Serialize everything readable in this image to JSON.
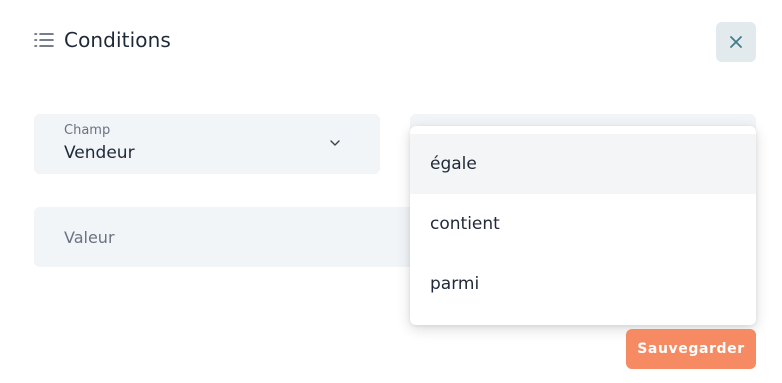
{
  "header": {
    "title": "Conditions",
    "icon": "list-icon"
  },
  "close_button": {
    "icon": "close-icon",
    "color": "#437a8c"
  },
  "field_select": {
    "label": "Champ",
    "value": "Vendeur",
    "icon": "chevron-down-icon"
  },
  "operator_select": {
    "options": [
      "égale",
      "contient",
      "parmi"
    ],
    "highlighted_index": 0
  },
  "value_input": {
    "placeholder": "Valeur",
    "value": ""
  },
  "save_button": {
    "label": "Sauvegarder",
    "color": "#f68a62"
  }
}
